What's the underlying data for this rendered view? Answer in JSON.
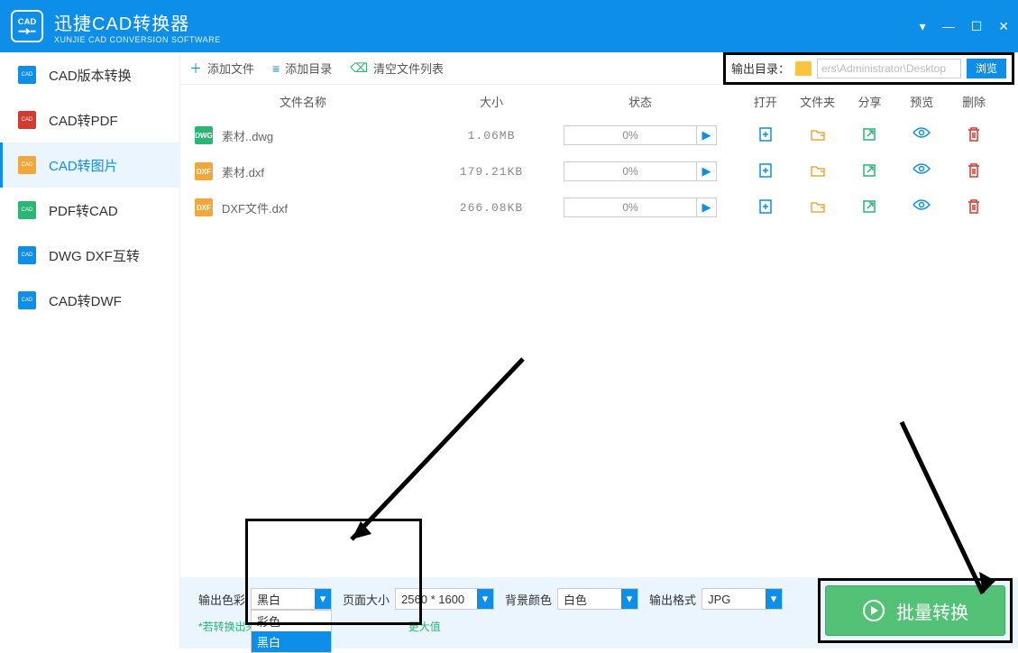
{
  "titlebar": {
    "title": "迅捷CAD转换器",
    "subtitle": "XUNJIE CAD CONVERSION SOFTWARE"
  },
  "sidebar": {
    "items": [
      {
        "label": "CAD版本转换",
        "icon_color": "#0d8ee9"
      },
      {
        "label": "CAD转PDF",
        "icon_color": "#d43a2f"
      },
      {
        "label": "CAD转图片",
        "icon_color": "#f2a73b"
      },
      {
        "label": "PDF转CAD",
        "icon_color": "#2bb673"
      },
      {
        "label": "DWG DXF互转",
        "icon_color": "#0d8ee9"
      },
      {
        "label": "CAD转DWF",
        "icon_color": "#0d8ee9"
      }
    ],
    "active_index": 2
  },
  "toolbar": {
    "add_file": "添加文件",
    "add_folder": "添加目录",
    "clear_list": "清空文件列表",
    "output_dir_label": "输出目录：",
    "output_dir_value": "ers\\Administrator\\Desktop",
    "browse": "浏览"
  },
  "table": {
    "headers": {
      "name": "文件名称",
      "size": "大小",
      "status": "状态",
      "open": "打开",
      "folder": "文件夹",
      "share": "分享",
      "preview": "预览",
      "delete": "删除"
    },
    "rows": [
      {
        "name": "素材..dwg",
        "size": "1.06MB",
        "progress": "0%",
        "icon_bg": "#2bb673",
        "icon_text": "DWG"
      },
      {
        "name": "素材.dxf",
        "size": "179.21KB",
        "progress": "0%",
        "icon_bg": "#f2a73b",
        "icon_text": "DXF"
      },
      {
        "name": "DXF文件.dxf",
        "size": "266.08KB",
        "progress": "0%",
        "icon_bg": "#f2a73b",
        "icon_text": "DXF"
      }
    ]
  },
  "options": {
    "color_label": "输出色彩",
    "color_value": "黑白",
    "color_options": [
      "彩色",
      "黑白"
    ],
    "page_label": "页面大小",
    "page_value": "2560 * 1600",
    "bg_label": "背景颜色",
    "bg_value": "白色",
    "format_label": "输出格式",
    "format_value": "JPG"
  },
  "hint": "*若转换出来的文字模糊，请调整页面大小至更大值",
  "hint_truncated_prefix": "*若转换出来的文字模糊，请",
  "hint_truncated_suffix": "更大值",
  "convert_button": "批量转换"
}
